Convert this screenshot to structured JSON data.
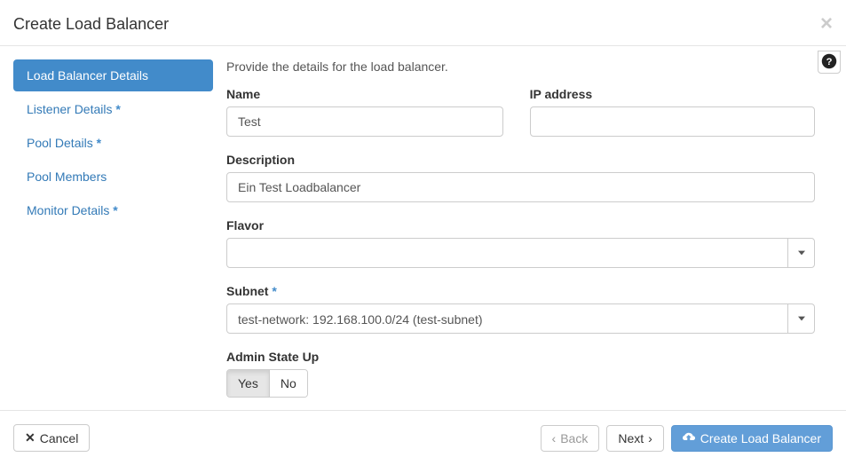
{
  "header": {
    "title": "Create Load Balancer"
  },
  "sidebar": {
    "items": [
      {
        "label": "Load Balancer Details",
        "required": false
      },
      {
        "label": "Listener Details",
        "required": true
      },
      {
        "label": "Pool Details",
        "required": true
      },
      {
        "label": "Pool Members",
        "required": false
      },
      {
        "label": "Monitor Details",
        "required": true
      }
    ]
  },
  "form": {
    "intro": "Provide the details for the load balancer.",
    "name_label": "Name",
    "name_value": "Test",
    "ip_label": "IP address",
    "ip_value": "",
    "description_label": "Description",
    "description_value": "Ein Test Loadbalancer",
    "flavor_label": "Flavor",
    "flavor_value": "",
    "subnet_label": "Subnet",
    "subnet_value": "test-network: 192.168.100.0/24 (test-subnet)",
    "admin_state_label": "Admin State Up",
    "admin_state_yes": "Yes",
    "admin_state_no": "No"
  },
  "footer": {
    "cancel": "Cancel",
    "back": "Back",
    "next": "Next",
    "submit": "Create Load Balancer"
  }
}
